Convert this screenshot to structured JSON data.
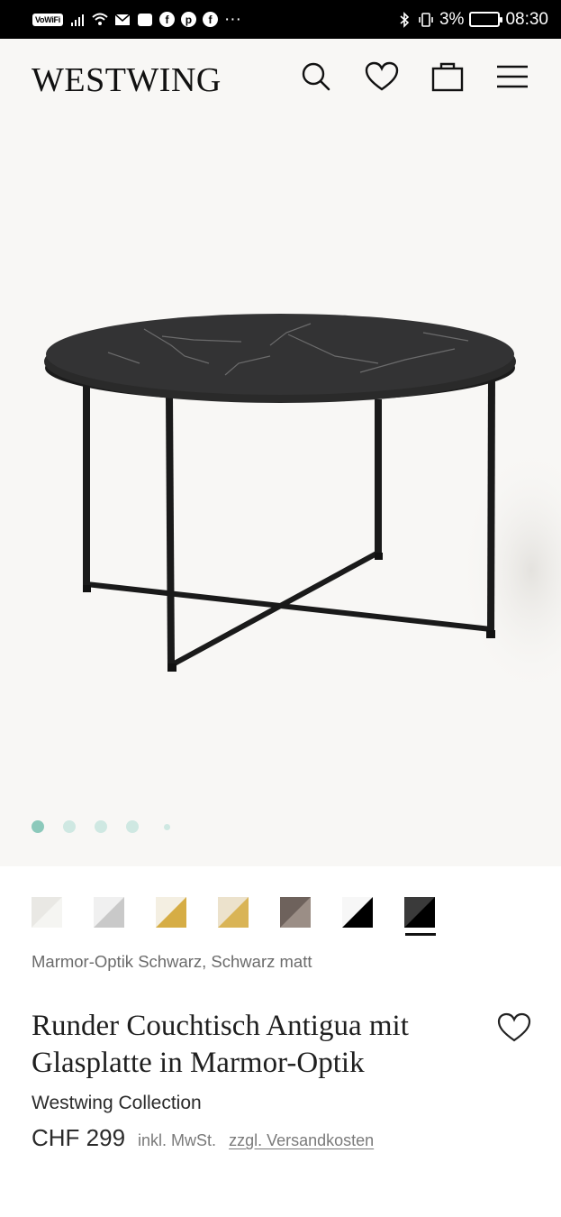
{
  "status_bar": {
    "vowifi": "VoWiFi",
    "battery_percent": "3%",
    "time": "08:30",
    "more": "···"
  },
  "header": {
    "logo": "WESTWING",
    "icons": [
      "search-icon",
      "heart-icon",
      "bag-icon",
      "menu-icon"
    ]
  },
  "gallery": {
    "dot_count": 5,
    "active_index": 0
  },
  "swatches": {
    "selected_index": 6,
    "colors": [
      {
        "a": "#e9e8e4",
        "b": "#f5f5f2"
      },
      {
        "a": "#f0f0f0",
        "b": "#c9c9c9"
      },
      {
        "a": "#f4efe2",
        "b": "#d6ad45"
      },
      {
        "a": "#ece2cc",
        "b": "#d9b456"
      },
      {
        "a": "#6e625c",
        "b": "#9b8e86"
      },
      {
        "a": "#f7f7f7",
        "b": "#000000"
      },
      {
        "a": "#3a3a3a",
        "b": "#000000"
      }
    ]
  },
  "product": {
    "variant": "Marmor-Optik Schwarz, Schwarz matt",
    "title": "Runder Couchtisch Antigua mit Glasplatte in Marmor-Optik",
    "brand": "Westwing Collection",
    "price": "CHF 299",
    "tax_note": "inkl. MwSt.",
    "shipping_link": "zzgl. Versandkosten"
  }
}
